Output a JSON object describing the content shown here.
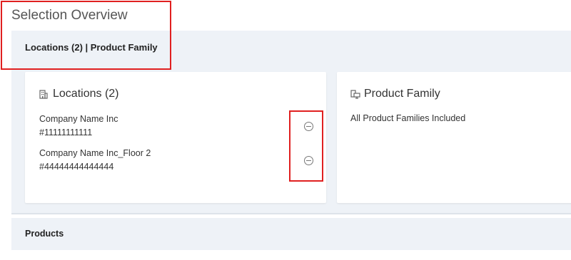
{
  "page": {
    "title": "Selection Overview",
    "breadcrumb": "Locations (2) | Product Family"
  },
  "locations_card": {
    "title": "Locations (2)",
    "icon": "building-icon",
    "items": [
      {
        "name": "Company Name Inc",
        "number": "#11111111111"
      },
      {
        "name": "Company Name Inc_Floor 2",
        "number": "#44444444444444"
      }
    ]
  },
  "family_card": {
    "title": "Product Family",
    "icon": "devices-icon",
    "text": "All Product Families Included"
  },
  "products": {
    "label": "Products"
  },
  "colors": {
    "highlight": "#e02020",
    "panel_bg": "#eef2f7"
  }
}
